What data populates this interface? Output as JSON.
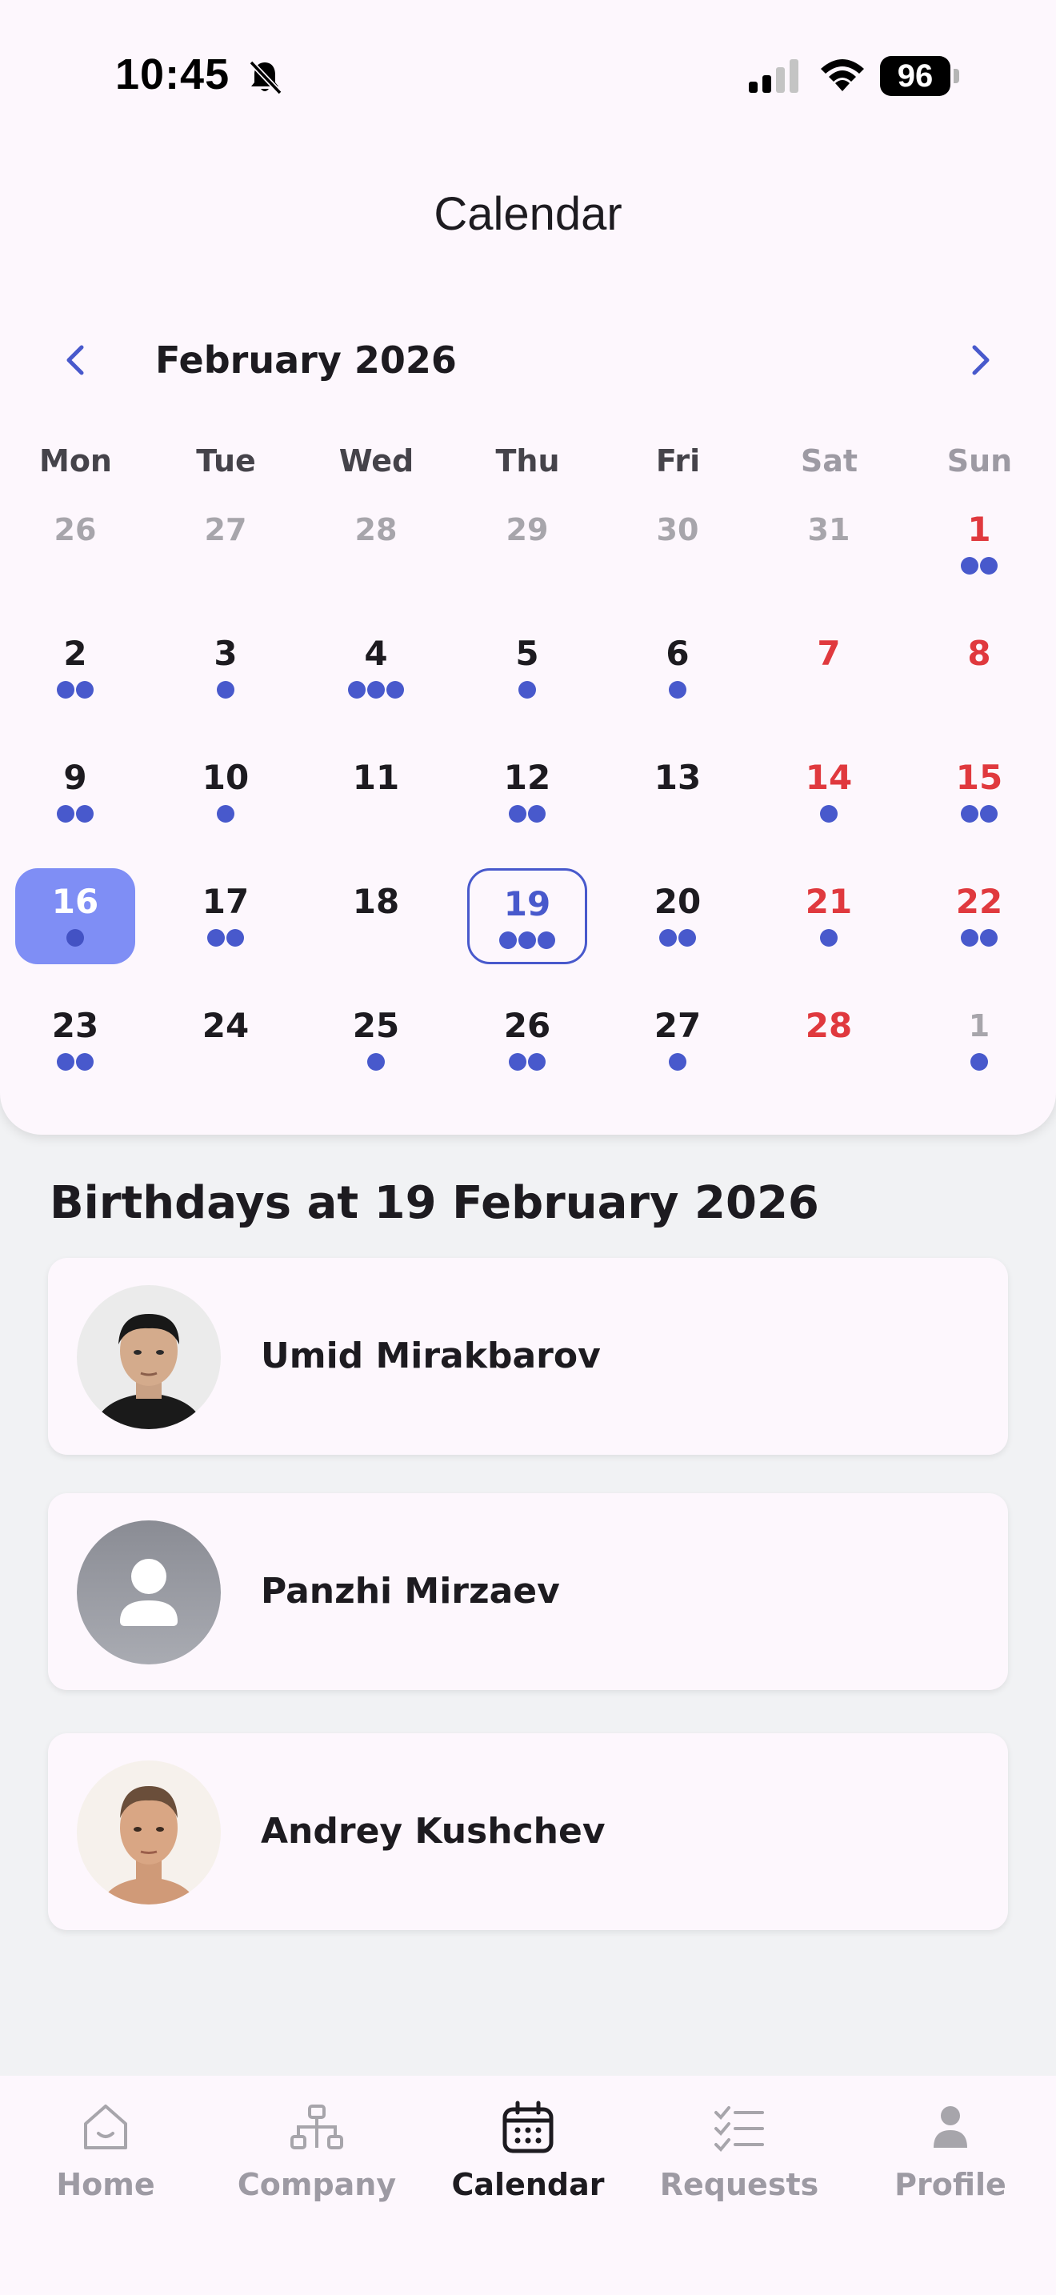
{
  "status_bar": {
    "time": "10:45",
    "battery": "96"
  },
  "header": {
    "title": "Calendar"
  },
  "calendar": {
    "month_label": "February 2026",
    "weekdays": [
      "Mon",
      "Tue",
      "Wed",
      "Thu",
      "Fri",
      "Sat",
      "Sun"
    ],
    "weeks": [
      [
        {
          "day": "26",
          "other": true,
          "dots": 0
        },
        {
          "day": "27",
          "other": true,
          "dots": 0
        },
        {
          "day": "28",
          "other": true,
          "dots": 0
        },
        {
          "day": "29",
          "other": true,
          "dots": 0
        },
        {
          "day": "30",
          "other": true,
          "dots": 0
        },
        {
          "day": "31",
          "other": true,
          "dots": 0
        },
        {
          "day": "1",
          "holiday": true,
          "dots": 2
        }
      ],
      [
        {
          "day": "2",
          "dots": 2
        },
        {
          "day": "3",
          "dots": 1
        },
        {
          "day": "4",
          "dots": 3
        },
        {
          "day": "5",
          "dots": 1
        },
        {
          "day": "6",
          "dots": 1
        },
        {
          "day": "7",
          "holiday": true,
          "dots": 0
        },
        {
          "day": "8",
          "holiday": true,
          "dots": 0
        }
      ],
      [
        {
          "day": "9",
          "dots": 2
        },
        {
          "day": "10",
          "dots": 1
        },
        {
          "day": "11",
          "dots": 0
        },
        {
          "day": "12",
          "dots": 2
        },
        {
          "day": "13",
          "dots": 0
        },
        {
          "day": "14",
          "holiday": true,
          "dots": 1
        },
        {
          "day": "15",
          "holiday": true,
          "dots": 2
        }
      ],
      [
        {
          "day": "16",
          "today": true,
          "dots": 1
        },
        {
          "day": "17",
          "dots": 2
        },
        {
          "day": "18",
          "dots": 0
        },
        {
          "day": "19",
          "selected": true,
          "dots": 3
        },
        {
          "day": "20",
          "dots": 2
        },
        {
          "day": "21",
          "holiday": true,
          "dots": 1
        },
        {
          "day": "22",
          "holiday": true,
          "dots": 2
        }
      ],
      [
        {
          "day": "23",
          "dots": 2
        },
        {
          "day": "24",
          "dots": 0
        },
        {
          "day": "25",
          "dots": 1
        },
        {
          "day": "26",
          "dots": 2
        },
        {
          "day": "27",
          "dots": 1
        },
        {
          "day": "28",
          "holiday": true,
          "dots": 0
        },
        {
          "day": "1",
          "other": true,
          "dots": 1
        }
      ]
    ],
    "colors": {
      "accent": "#4859cc",
      "today_bg": "#7f8ef5",
      "holiday": "#e0393e",
      "muted": "#a7a5ab"
    }
  },
  "birthdays": {
    "title": "Birthdays at 19 February 2026",
    "people": [
      {
        "name": "Umid Mirakbarov",
        "avatar": "photo"
      },
      {
        "name": "Panzhi Mirzaev",
        "avatar": "placeholder"
      },
      {
        "name": "Andrey Kushchev",
        "avatar": "photo"
      }
    ]
  },
  "nav": {
    "items": [
      {
        "label": "Home",
        "icon": "home-icon",
        "active": false
      },
      {
        "label": "Company",
        "icon": "org-chart-icon",
        "active": false
      },
      {
        "label": "Calendar",
        "icon": "calendar-icon",
        "active": true
      },
      {
        "label": "Requests",
        "icon": "checklist-icon",
        "active": false
      },
      {
        "label": "Profile",
        "icon": "person-icon",
        "active": false
      }
    ]
  }
}
